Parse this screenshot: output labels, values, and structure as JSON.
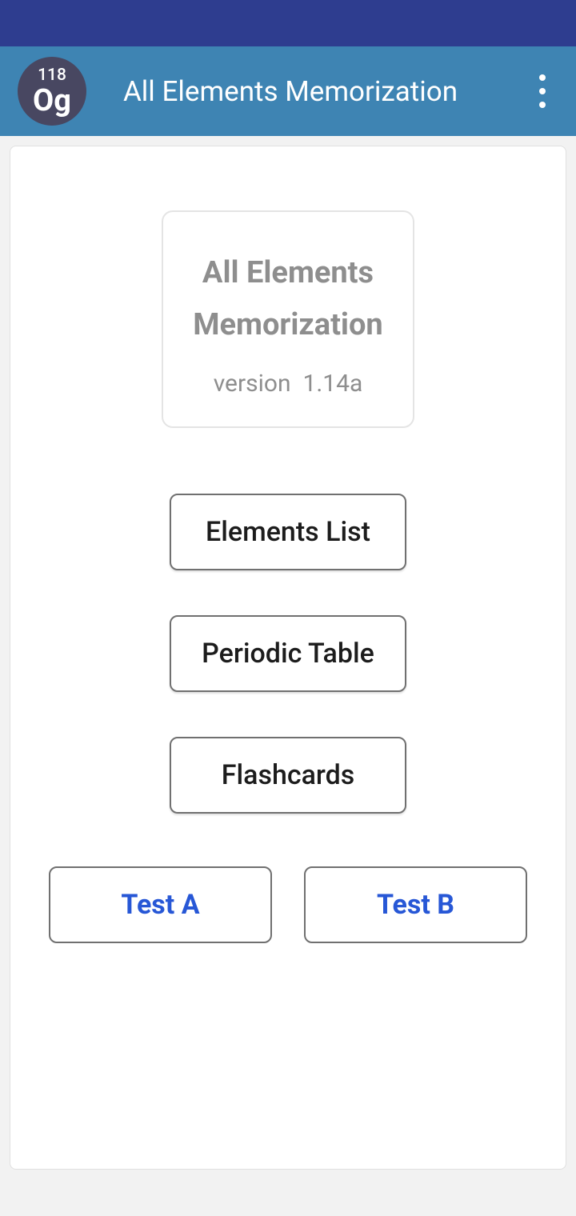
{
  "header": {
    "icon": {
      "number": "118",
      "symbol": "Og"
    },
    "title": "All Elements Memorization"
  },
  "titleBox": {
    "line1": "All Elements",
    "line2": "Memorization",
    "versionLabel": "version",
    "versionValue": "1.14a"
  },
  "menu": {
    "elementsList": "Elements List",
    "periodicTable": "Periodic Table",
    "flashcards": "Flashcards"
  },
  "tests": {
    "a": "Test A",
    "b": "Test B"
  }
}
